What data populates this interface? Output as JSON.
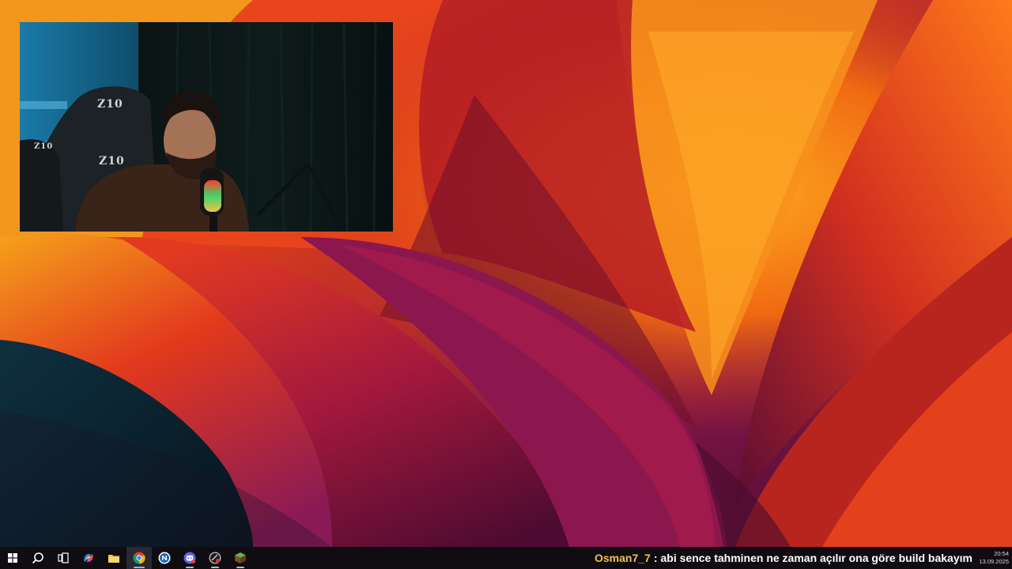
{
  "wallpaper": {
    "name": "abstract-orange-magenta-wallpaper",
    "colors": [
      "#e8521c",
      "#c21f2b",
      "#f59a1d",
      "#8f1f5c",
      "#4a0b2e",
      "#0b2230"
    ]
  },
  "webcam": {
    "chair_brand": "Z10"
  },
  "taskbar": {
    "icons": [
      {
        "name": "start-button",
        "icon": "windows-logo-icon"
      },
      {
        "name": "search-button",
        "icon": "search-icon"
      },
      {
        "name": "task-view-button",
        "icon": "task-view-icon"
      },
      {
        "name": "copilot-button",
        "icon": "copilot-icon"
      },
      {
        "name": "file-explorer-button",
        "icon": "folder-icon"
      },
      {
        "name": "chrome-button",
        "icon": "chrome-icon"
      },
      {
        "name": "app-n-button",
        "icon": "n-app-icon"
      },
      {
        "name": "discord-button",
        "icon": "discord-icon"
      },
      {
        "name": "app-game-button",
        "icon": "game-launcher-icon"
      },
      {
        "name": "minecraft-button",
        "icon": "minecraft-icon"
      }
    ],
    "ticker": {
      "user": "Osman7_7",
      "separator": ":",
      "message": "abi sence tahminen ne zaman açılır ona göre build bakayım"
    },
    "clock": {
      "time": "20:54",
      "date": "13.09.2025"
    },
    "accent": "#8ab4f8"
  }
}
